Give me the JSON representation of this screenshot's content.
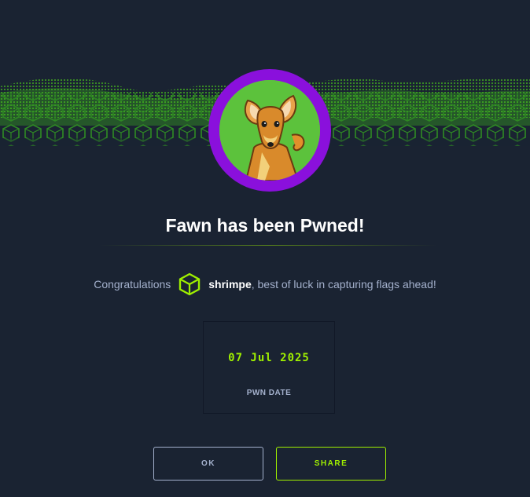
{
  "machine": {
    "title": "Fawn has been Pwned!",
    "avatar_icon": "fawn-avatar-icon"
  },
  "congrats": {
    "prefix": "Congratulations",
    "username": "shrimpe",
    "suffix": ", best of luck in capturing flags ahead!",
    "user_icon": "htb-cube-icon"
  },
  "pwn_date": {
    "value": "07 Jul 2025",
    "label": "PWN DATE"
  },
  "buttons": {
    "ok_label": "OK",
    "share_label": "SHARE"
  },
  "colors": {
    "background": "#1a2332",
    "accent": "#9fef00",
    "muted_text": "#a4b1cd",
    "avatar_ring": "#8a10dc"
  }
}
